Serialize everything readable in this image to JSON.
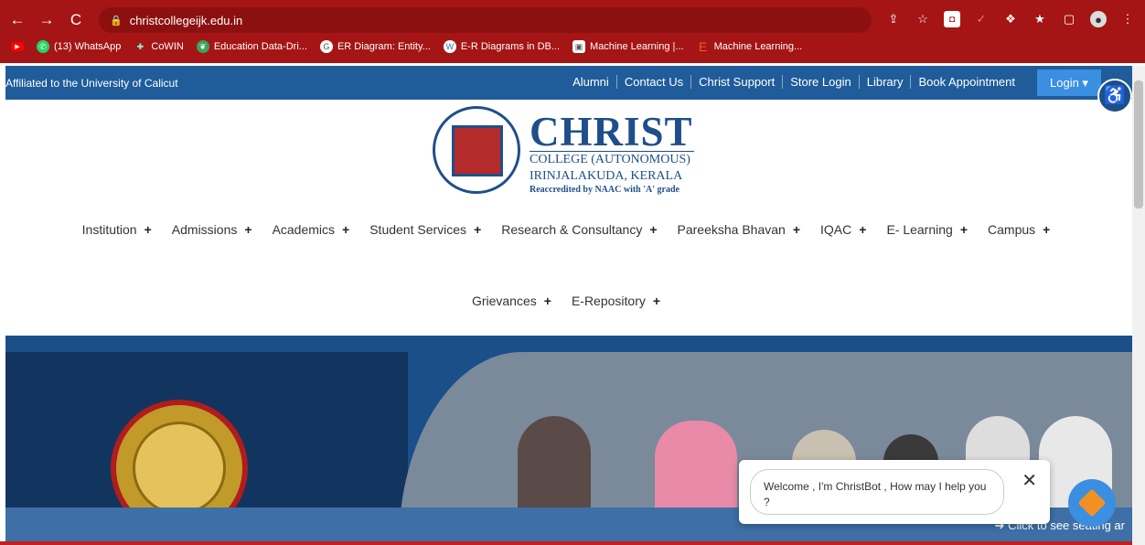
{
  "browser": {
    "url": "christcollegeijk.edu.in",
    "bookmarks": [
      {
        "label": "(13) WhatsApp",
        "icon": "whatsapp-icon",
        "color": "#25d366"
      },
      {
        "label": "CoWIN",
        "icon": "cowin-icon",
        "color": "#1a73e8"
      },
      {
        "label": "Education Data-Dri...",
        "icon": "leaf-icon",
        "color": "#3aa35b"
      },
      {
        "label": "ER Diagram: Entity...",
        "icon": "circle-icon",
        "color": "#555"
      },
      {
        "label": "E-R Diagrams in DB...",
        "icon": "wordpress-icon",
        "color": "#21759b"
      },
      {
        "label": "Machine Learning |...",
        "icon": "ml-icon",
        "color": "#666"
      },
      {
        "label": "Machine Learning...",
        "icon": "e-icon",
        "color": "#f05a28"
      }
    ]
  },
  "topbar": {
    "affiliation": "Affiliated to the University of Calicut",
    "links": [
      "Alumni",
      "Contact Us",
      "Christ Support",
      "Store Login",
      "Library",
      "Book Appointment"
    ],
    "login_label": "Login ▾"
  },
  "logo": {
    "title": "CHRIST",
    "line1": "COLLEGE (AUTONOMOUS)",
    "line2": "IRINJALAKUDA, KERALA",
    "line3": "Reaccredited by NAAC with 'A' grade"
  },
  "nav": {
    "row1": [
      "Institution",
      "Admissions",
      "Academics",
      "Student Services",
      "Research & Consultancy",
      "Pareeksha Bhavan",
      "IQAC",
      "E- Learning",
      "Campus"
    ],
    "row2": [
      "Grievances",
      "E-Repository"
    ],
    "plus": "+"
  },
  "hero": {
    "seating_text": "➔  Click to see seating ar"
  },
  "chat": {
    "message": "Welcome , I'm ChristBot , How may I help you ?",
    "close": "✕"
  },
  "colors": {
    "browser_red": "#a51515",
    "site_blue": "#1f5c99",
    "login_blue": "#3a8fe0"
  }
}
